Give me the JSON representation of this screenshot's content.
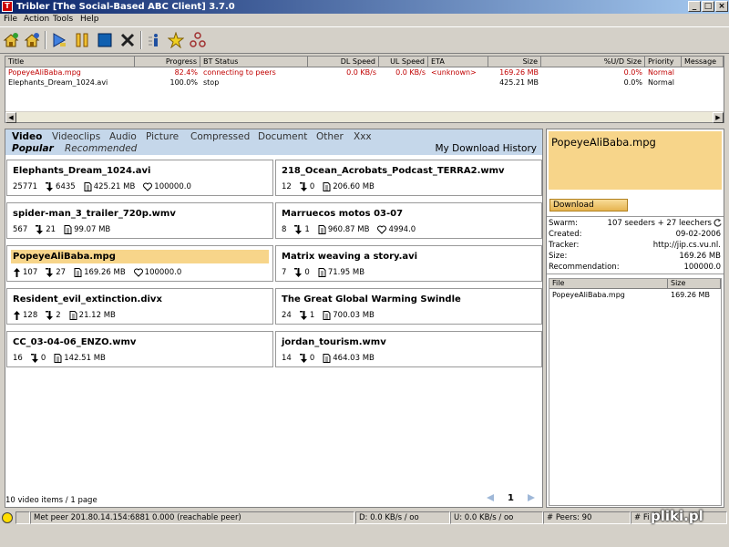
{
  "window": {
    "title": "Tribler [The Social-Based ABC Client] 3.7.0",
    "min": "_",
    "max": "□",
    "close": "×"
  },
  "menu": [
    "File",
    "Action",
    "Tools",
    "Help"
  ],
  "toolbar_icons": [
    "add-torrent-icon",
    "add-from-url-icon",
    "resume-icon",
    "pause-icon",
    "stop-icon",
    "remove-icon",
    "info-icon",
    "favorite-icon",
    "friends-icon"
  ],
  "torrents": {
    "headers": [
      "Title",
      "Progress",
      "BT Status",
      "DL Speed",
      "UL Speed",
      "ETA",
      "Size",
      "%U/D Size",
      "Priority",
      "Message"
    ],
    "rows": [
      [
        "PopeyeAliBaba.mpg",
        "82.4%",
        "connecting to peers",
        "0.0 KB/s",
        "0.0 KB/s",
        "<unknown>",
        "169.26 MB",
        "0.0%",
        "Normal",
        ""
      ],
      [
        "Elephants_Dream_1024.avi",
        "100.0%",
        "stop",
        "",
        "",
        "",
        "425.21 MB",
        "0.0%",
        "Normal",
        ""
      ]
    ]
  },
  "categories": [
    "Video",
    "Videoclips",
    "Audio",
    "Picture",
    "Compressed",
    "Document",
    "Other",
    "Xxx"
  ],
  "subtabs": [
    "Popular",
    "Recommended"
  ],
  "history": "My Download History",
  "items": [
    {
      "name": "Elephants_Dream_1024.avi",
      "seed": "25771",
      "leech": "6435",
      "size": "425.21 MB",
      "rec": "100000.0",
      "seedArrow": false,
      "hasRec": true
    },
    {
      "name": "218_Ocean_Acrobats_Podcast_TERRA2.wmv",
      "seed": "12",
      "leech": "0",
      "size": "206.60 MB",
      "rec": "",
      "seedArrow": false,
      "hasRec": false
    },
    {
      "name": "spider-man_3_trailer_720p.wmv",
      "seed": "567",
      "leech": "21",
      "size": "99.07 MB",
      "rec": "",
      "seedArrow": false,
      "hasRec": false
    },
    {
      "name": "Marruecos motos 03-07",
      "seed": "8",
      "leech": "1",
      "size": "960.87 MB",
      "rec": "4994.0",
      "seedArrow": false,
      "hasRec": true
    },
    {
      "name": "PopeyeAliBaba.mpg",
      "seed": "107",
      "leech": "27",
      "size": "169.26 MB",
      "rec": "100000.0",
      "seedArrow": true,
      "hasRec": true
    },
    {
      "name": "Matrix weaving a story.avi",
      "seed": "7",
      "leech": "0",
      "size": "71.95 MB",
      "rec": "",
      "seedArrow": false,
      "hasRec": false
    },
    {
      "name": "Resident_evil_extinction.divx",
      "seed": "128",
      "leech": "2",
      "size": "21.12 MB",
      "rec": "",
      "seedArrow": true,
      "hasRec": false
    },
    {
      "name": "The Great Global Warming Swindle",
      "seed": "24",
      "leech": "1",
      "size": "700.03 MB",
      "rec": "",
      "seedArrow": false,
      "hasRec": false
    },
    {
      "name": "CC_03-04-06_ENZO.wmv",
      "seed": "16",
      "leech": "0",
      "size": "142.51 MB",
      "rec": "",
      "seedArrow": false,
      "hasRec": false
    },
    {
      "name": "jordan_tourism.wmv",
      "seed": "14",
      "leech": "0",
      "size": "464.03 MB",
      "rec": "",
      "seedArrow": false,
      "hasRec": false
    }
  ],
  "footer": {
    "count": "10 video items / 1 page",
    "page": "1"
  },
  "details": {
    "title": "PopeyeAliBaba.mpg",
    "download": "Download",
    "fields": [
      {
        "label": "Swarm:",
        "value": "107 seeders + 27 leechers"
      },
      {
        "label": "Created:",
        "value": "09-02-2006"
      },
      {
        "label": "Tracker:",
        "value": "http://jip.cs.vu.nl."
      },
      {
        "label": "Size:",
        "value": "169.26 MB"
      },
      {
        "label": "Recommendation:",
        "value": "100000.0"
      }
    ],
    "file_headers": [
      "File",
      "Size"
    ],
    "files": [
      {
        "name": "PopeyeAliBaba.mpg",
        "size": "169.26 MB"
      }
    ]
  },
  "status": {
    "peer": "Met peer   201.80.14.154:6881 0.000 (reachable peer)",
    "down": "D: 0.0 KB/s / oo",
    "up": "U: 0.0 KB/s / oo",
    "peers": "# Peers: 90",
    "files": "# Fi"
  },
  "watermark": "pliki.pl"
}
